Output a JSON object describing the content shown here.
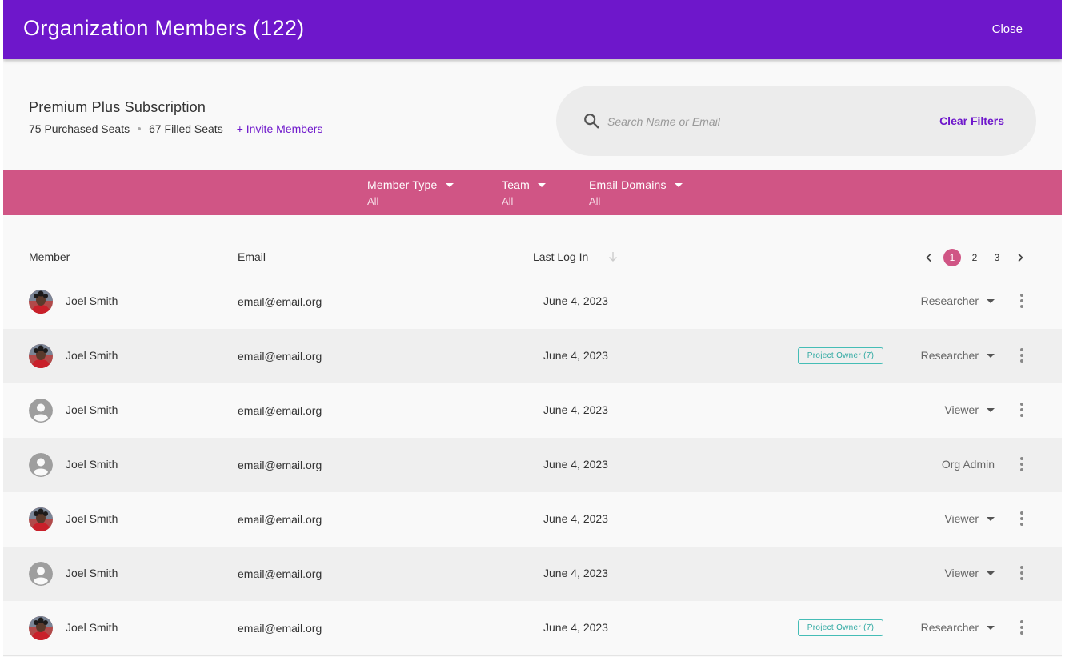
{
  "header": {
    "title": "Organization Members (122)",
    "close_label": "Close",
    "background": "#6e17cb"
  },
  "subscription": {
    "name": "Premium Plus Subscription",
    "purchased": "75 Purchased Seats",
    "filled": "67 Filled Seats",
    "invite_label": "+ Invite Members"
  },
  "search": {
    "placeholder": "Search Name or Email",
    "value": "",
    "clear_label": "Clear Filters",
    "icon": "search-icon"
  },
  "filters": {
    "background": "#d05585",
    "items": [
      {
        "label": "Member Type",
        "value": "All"
      },
      {
        "label": "Team",
        "value": "All"
      },
      {
        "label": "Email Domains",
        "value": "All"
      }
    ]
  },
  "table": {
    "columns": {
      "member": "Member",
      "email": "Email",
      "last_login": "Last Log In"
    },
    "sort": "last_login-desc",
    "pagination": {
      "pages": [
        "1",
        "2",
        "3"
      ],
      "current": "1"
    },
    "rows": [
      {
        "avatar": "photo",
        "name": "Joel Smith",
        "email": "email@email.org",
        "last_login": "June 4, 2023",
        "badge": "",
        "role": "Researcher",
        "role_dropdown": true
      },
      {
        "avatar": "photo",
        "name": "Joel Smith",
        "email": "email@email.org",
        "last_login": "June 4, 2023",
        "badge": "Project Owner (7)",
        "role": "Researcher",
        "role_dropdown": true
      },
      {
        "avatar": "placeholder",
        "name": "Joel Smith",
        "email": "email@email.org",
        "last_login": "June 4, 2023",
        "badge": "",
        "role": "Viewer",
        "role_dropdown": true
      },
      {
        "avatar": "placeholder",
        "name": "Joel Smith",
        "email": "email@email.org",
        "last_login": "June 4, 2023",
        "badge": "",
        "role": "Org Admin",
        "role_dropdown": false
      },
      {
        "avatar": "photo",
        "name": "Joel Smith",
        "email": "email@email.org",
        "last_login": "June 4, 2023",
        "badge": "",
        "role": "Viewer",
        "role_dropdown": true
      },
      {
        "avatar": "placeholder",
        "name": "Joel Smith",
        "email": "email@email.org",
        "last_login": "June 4, 2023",
        "badge": "",
        "role": "Viewer",
        "role_dropdown": true
      },
      {
        "avatar": "photo",
        "name": "Joel Smith",
        "email": "email@email.org",
        "last_login": "June 4, 2023",
        "badge": "Project Owner (7)",
        "role": "Researcher",
        "role_dropdown": true
      }
    ]
  },
  "colors": {
    "accent": "#6e17cb",
    "filter_bar": "#d05585",
    "badge": "#45bdb6",
    "row_alt": "#efefef"
  }
}
